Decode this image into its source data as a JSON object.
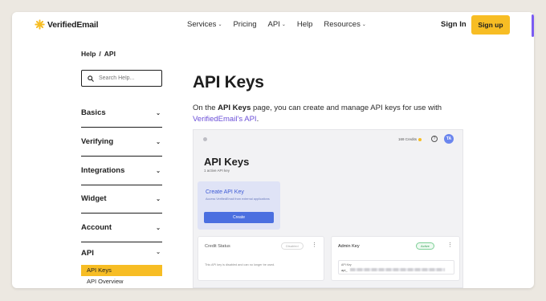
{
  "nav": {
    "brand": "VerifiedEmail",
    "links": [
      {
        "label": "Services",
        "has_menu": true
      },
      {
        "label": "Pricing",
        "has_menu": false
      },
      {
        "label": "API",
        "has_menu": true
      },
      {
        "label": "Help",
        "has_menu": false
      },
      {
        "label": "Resources",
        "has_menu": true
      }
    ],
    "chevron": "⌄",
    "sign_in": "Sign In",
    "sign_up": "Sign up"
  },
  "breadcrumb": {
    "items": [
      "Help",
      "API"
    ],
    "separator": "/"
  },
  "search": {
    "placeholder": "Search Help..."
  },
  "sidebar": {
    "sections": [
      "Basics",
      "Verifying",
      "Integrations",
      "Widget",
      "Account"
    ],
    "api_section": "API",
    "api_items": [
      {
        "label": "API Keys",
        "active": true
      },
      {
        "label": "API Overview",
        "active": false
      }
    ]
  },
  "content": {
    "title": "API Keys",
    "intro_pre": "On the ",
    "intro_bold": "API Keys",
    "intro_mid": " page, you can create and manage API keys for use with ",
    "intro_link": "VerifiedEmail’s API",
    "intro_post": "."
  },
  "screenshot": {
    "credits": "169 Credits",
    "avatar_initials": "TA",
    "title": "API Keys",
    "subtitle": "1 active API key",
    "create_card": {
      "title": "Create API Key",
      "description": "Access VerifiedEmail from external applications",
      "button": "Create"
    },
    "credit_status": {
      "title": "Credit Status",
      "badge": "Disabled",
      "note": "This API key is disabled and can no longer be used."
    },
    "admin_key": {
      "title": "Admin Key",
      "badge": "Active",
      "field_label": "API Key",
      "field_value_prefix": "api_"
    }
  },
  "colors": {
    "accent_yellow": "#f7bd24",
    "link_purple": "#6b4fd8",
    "page_bg": "#ece8e1",
    "primary_blue": "#4b6fe0"
  }
}
